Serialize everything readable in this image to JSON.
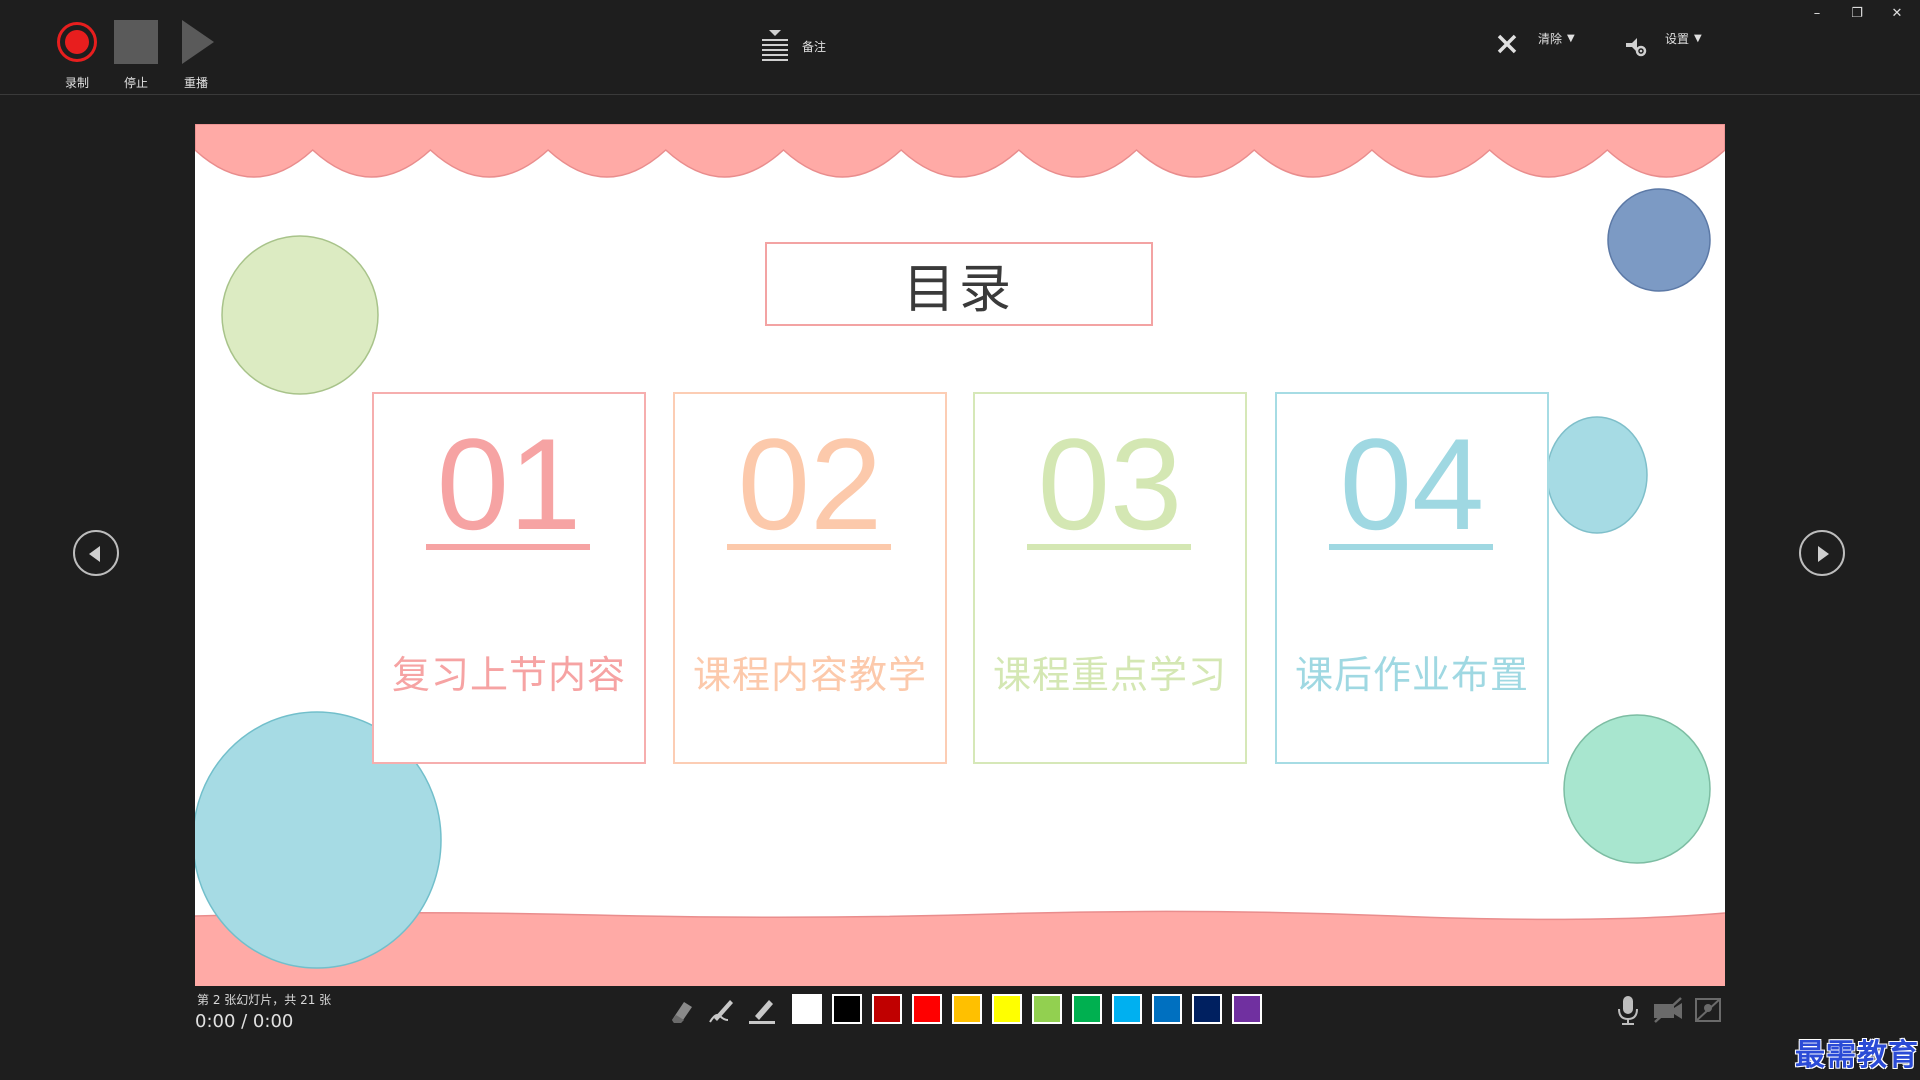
{
  "toolbar": {
    "record_label": "录制",
    "stop_label": "停止",
    "replay_label": "重播",
    "notes_label": "备注",
    "clear_label": "清除",
    "settings_label": "设置"
  },
  "window": {
    "min": "–",
    "restore": "❐",
    "close": "✕"
  },
  "slide": {
    "title": "目录",
    "cards": [
      {
        "number": "01",
        "text": "复习上节内容",
        "color": "#f6a3a3"
      },
      {
        "number": "02",
        "text": "课程内容教学",
        "color": "#fcc9ab"
      },
      {
        "number": "03",
        "text": "课程重点学习",
        "color": "#d4e7b3"
      },
      {
        "number": "04",
        "text": "课后作业布置",
        "color": "#9fd8e2"
      }
    ],
    "colors": {
      "pink": "#ffaaa6",
      "green": "#dcebc2",
      "navy": "#7c9ac4",
      "cyan": "#a6dbe4",
      "mint": "#a8e6cf"
    }
  },
  "status": {
    "counter": "第 2 张幻灯片，共 21 张",
    "time": "0:00  /  0:00"
  },
  "palette": [
    "#ffffff",
    "#000000",
    "#c00000",
    "#ff0000",
    "#ffc000",
    "#ffff00",
    "#92d050",
    "#00b050",
    "#00b0f0",
    "#0070c0",
    "#002060",
    "#7030a0"
  ],
  "watermark": "最需教育"
}
